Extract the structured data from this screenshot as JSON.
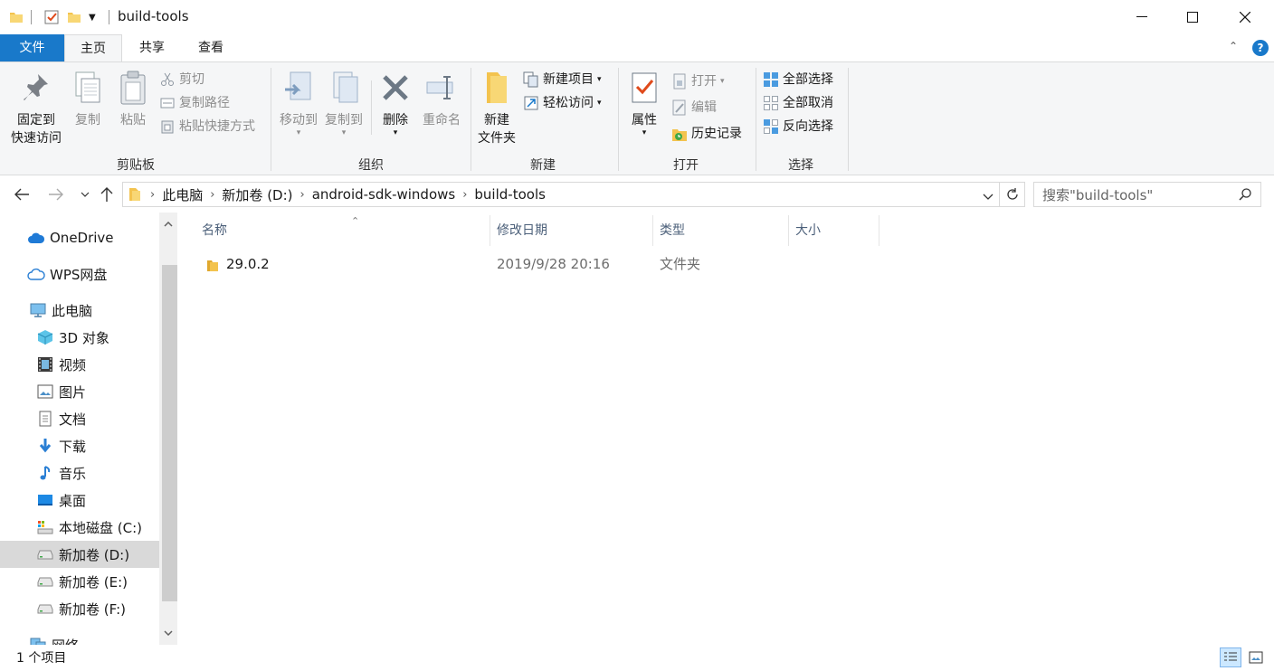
{
  "window": {
    "title": "build-tools",
    "minimize_glyph": "—",
    "maximize_glyph": "☐",
    "close_glyph": "✕"
  },
  "ribbon_tabs": {
    "file": "文件",
    "home": "主页",
    "share": "共享",
    "view": "查看"
  },
  "ribbon": {
    "clipboard": {
      "pin_line1": "固定到",
      "pin_line2": "快速访问",
      "copy": "复制",
      "paste": "粘贴",
      "cut": "剪切",
      "copy_path": "复制路径",
      "paste_shortcut": "粘贴快捷方式",
      "label": "剪贴板"
    },
    "organize": {
      "move_to": "移动到",
      "copy_to": "复制到",
      "delete": "删除",
      "rename": "重命名",
      "label": "组织"
    },
    "new": {
      "new_folder_line1": "新建",
      "new_folder_line2": "文件夹",
      "new_item": "新建项目",
      "easy_access": "轻松访问",
      "label": "新建"
    },
    "open": {
      "properties": "属性",
      "open": "打开",
      "edit": "编辑",
      "history": "历史记录",
      "label": "打开"
    },
    "select": {
      "select_all": "全部选择",
      "select_none": "全部取消",
      "invert": "反向选择",
      "label": "选择"
    }
  },
  "address": {
    "crumbs": [
      "此电脑",
      "新加卷 (D:)",
      "android-sdk-windows",
      "build-tools"
    ],
    "search_placeholder": "搜索\"build-tools\""
  },
  "nav_pane": {
    "items": [
      {
        "label": "OneDrive",
        "icon": "cloud-icon"
      },
      {
        "label": "WPS网盘",
        "icon": "cloud-outline-icon"
      },
      {
        "label": "此电脑",
        "icon": "computer-icon"
      },
      {
        "label": "3D 对象",
        "icon": "cube-icon"
      },
      {
        "label": "视频",
        "icon": "film-icon"
      },
      {
        "label": "图片",
        "icon": "picture-icon"
      },
      {
        "label": "文档",
        "icon": "document-icon"
      },
      {
        "label": "下载",
        "icon": "download-icon"
      },
      {
        "label": "音乐",
        "icon": "music-icon"
      },
      {
        "label": "桌面",
        "icon": "desktop-icon"
      },
      {
        "label": "本地磁盘 (C:)",
        "icon": "system-drive-icon"
      },
      {
        "label": "新加卷 (D:)",
        "icon": "drive-icon",
        "selected": true
      },
      {
        "label": "新加卷 (E:)",
        "icon": "drive-icon"
      },
      {
        "label": "新加卷 (F:)",
        "icon": "drive-icon"
      },
      {
        "label": "网络",
        "icon": "network-icon"
      }
    ]
  },
  "file_list": {
    "columns": [
      "名称",
      "修改日期",
      "类型",
      "大小"
    ],
    "rows": [
      {
        "name": "29.0.2",
        "modified": "2019/9/28 20:16",
        "type": "文件夹",
        "size": ""
      }
    ]
  },
  "status": {
    "item_count": "1 个项目"
  },
  "colors": {
    "accent": "#1979ca",
    "folder": "#f3c34e",
    "ribbon_bg": "#f5f6f7"
  }
}
